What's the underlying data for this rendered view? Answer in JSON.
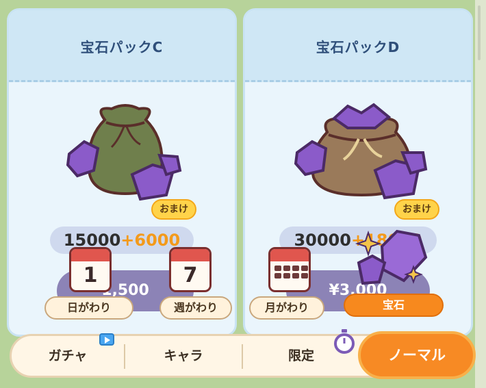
{
  "packs": [
    {
      "title": "宝石パックC",
      "amount": "15000",
      "bonus": "+6000",
      "bonus_tag": "おまけ",
      "price": "1,500"
    },
    {
      "title": "宝石パックD",
      "amount": "30000",
      "bonus": "+18000",
      "bonus_tag": "おまけ",
      "price": "¥3,000"
    }
  ],
  "tooltip": {
    "daily_day": "1",
    "daily_label": "日がわり",
    "weekly_day": "7",
    "weekly_label": "週がわり",
    "monthly_label": "月がわり",
    "gem_label": "宝石"
  },
  "tabs": {
    "gacha": "ガチャ",
    "chara": "キャラ",
    "limited": "限定",
    "normal": "ノーマル"
  },
  "colors": {
    "accent": "#f78a24",
    "card_bg": "#eaf5fc",
    "gem": "#8b5bc9"
  },
  "icons": [
    "gem-bag-icon",
    "calendar-icon",
    "play-icon",
    "stopwatch-icon",
    "gem-icon",
    "sparkle-icon"
  ]
}
